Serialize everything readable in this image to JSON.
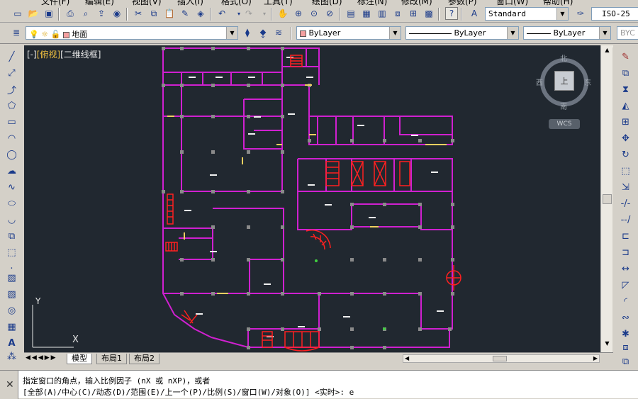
{
  "menubar": {
    "items": [
      "文件(F)",
      "编辑(E)",
      "视图(V)",
      "插入(I)",
      "格式(O)",
      "工具(T)",
      "绘图(D)",
      "标注(N)",
      "修改(M)",
      "参数(P)",
      "窗口(W)",
      "帮助(H)"
    ]
  },
  "toolbar1": {
    "text_style": "Standard",
    "dim_style": "ISO-25"
  },
  "toolbar2": {
    "layer": "地面",
    "color": "ByLayer",
    "linetype": "ByLayer",
    "lineweight": "ByLayer",
    "plotstyle": "BYC"
  },
  "viewport": {
    "label_prefix": "[-]",
    "label_view": "[俯视]",
    "label_style": "[二维线框]",
    "viewcube": {
      "north": "北",
      "south": "南",
      "east": "东",
      "west": "西",
      "face": "上",
      "wcs": "WCS"
    },
    "ucs": {
      "x": "X",
      "y": "Y"
    }
  },
  "layout_tabs": [
    "模型",
    "布局1",
    "布局2"
  ],
  "command": {
    "line1": "指定窗口的角点，输入比例因子 (nX 或 nXP)，或者",
    "line2": "[全部(A)/中心(C)/动态(D)/范围(E)/上一个(P)/比例(S)/窗口(W)/对象(O)] <实时>: e"
  },
  "colors": {
    "canvas": "#212830",
    "wall": "#d020d0",
    "red": "#ff2020",
    "column": "#8a8a8a"
  }
}
